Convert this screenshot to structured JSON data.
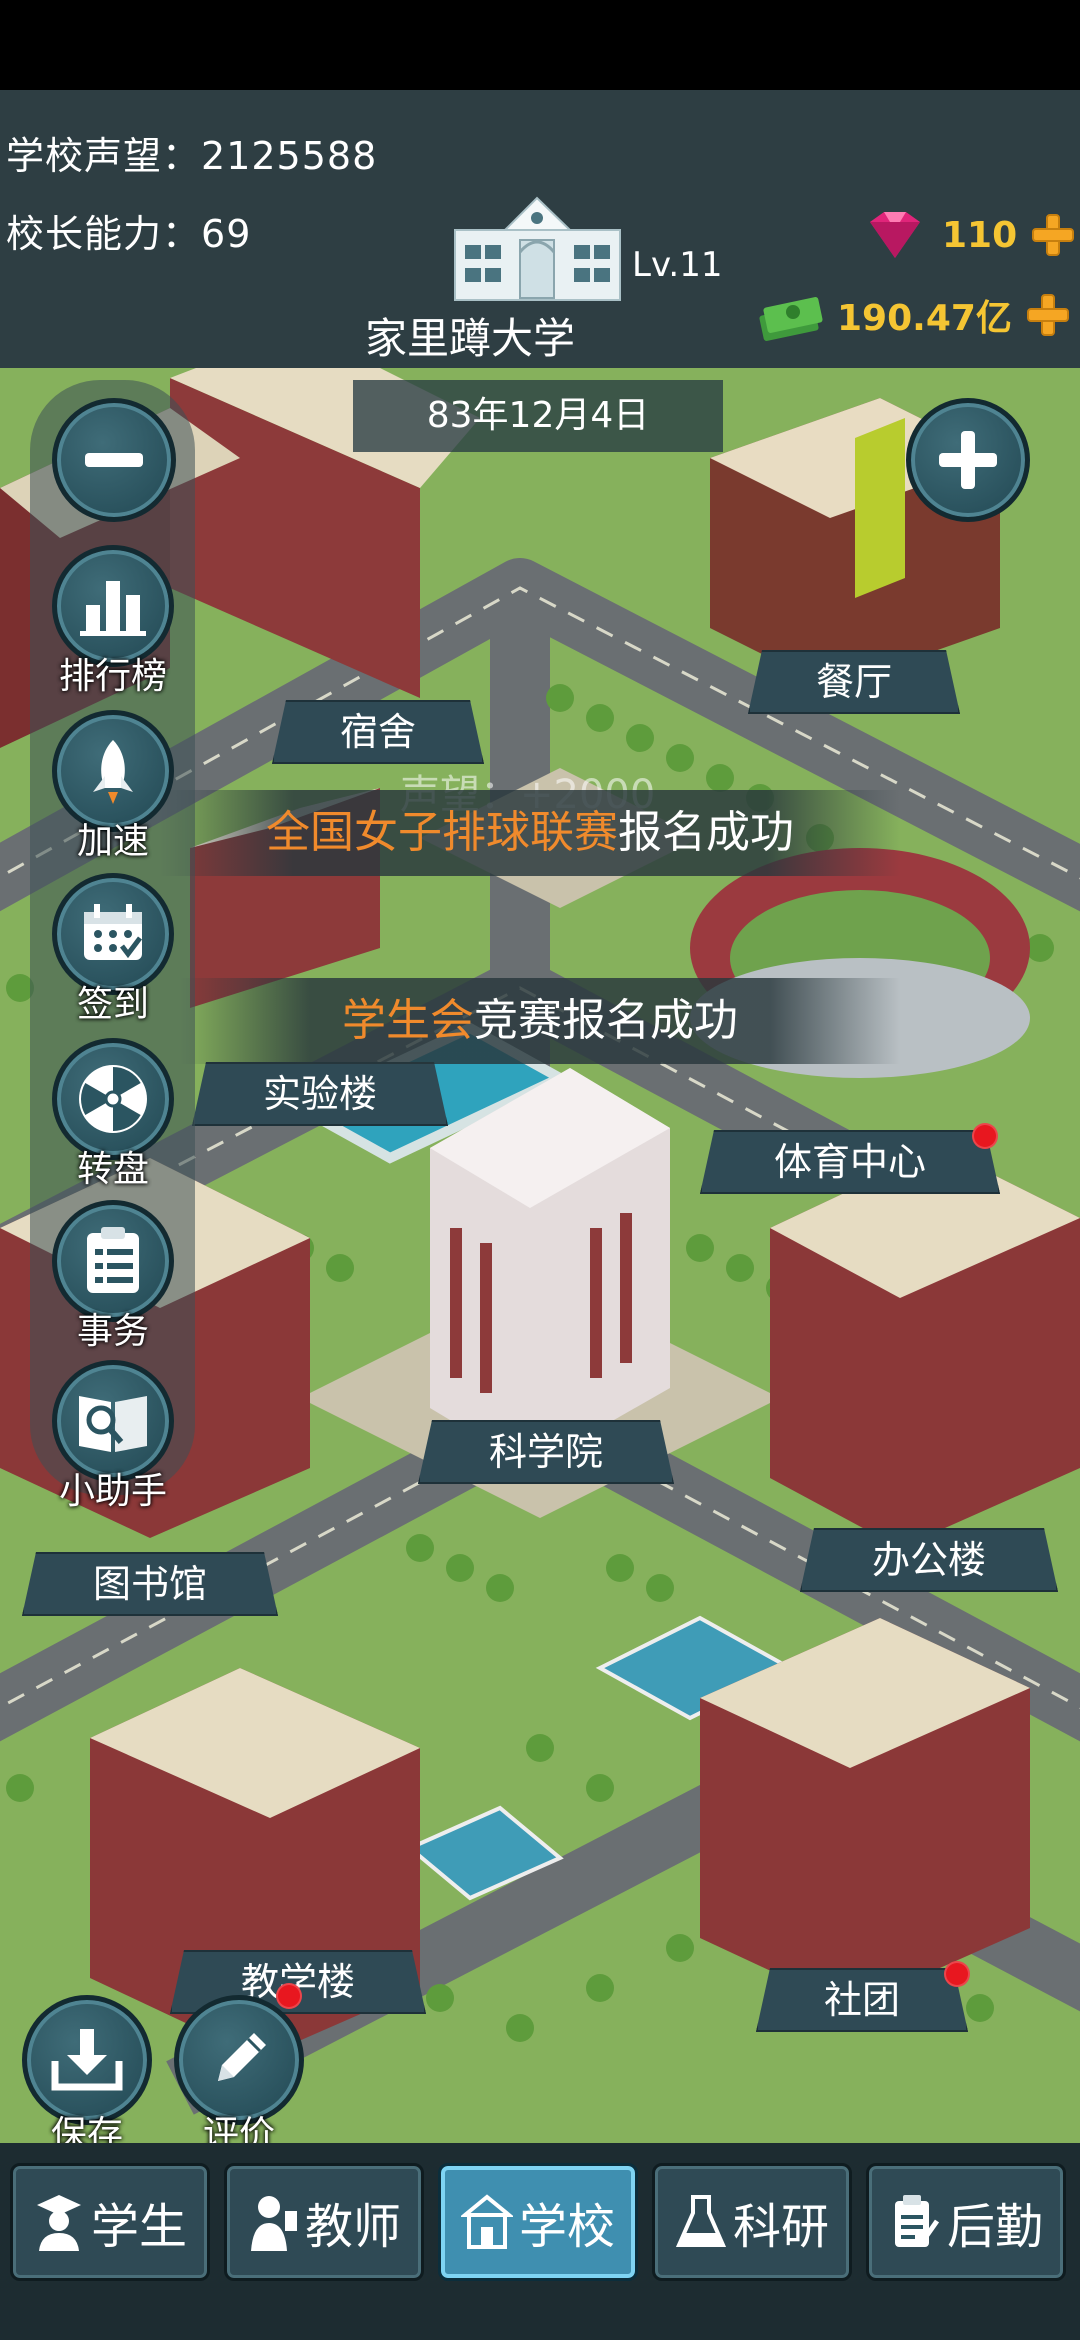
{
  "header": {
    "reputation_label": "学校声望：",
    "reputation_value": "2125588",
    "ability_label": "校长能力：",
    "ability_value": "69",
    "school_level": "Lv.11",
    "school_name": "家里蹲大学",
    "gems": "110",
    "money": "190.47亿",
    "gem_icon": "gem-icon",
    "money_icon": "cash-icon"
  },
  "map": {
    "date": "83年12月4日",
    "buildings": [
      {
        "label": "宿舍"
      },
      {
        "label": "餐厅"
      },
      {
        "label": "实验楼"
      },
      {
        "label": "体育中心"
      },
      {
        "label": "科学院"
      },
      {
        "label": "办公楼"
      },
      {
        "label": "图书馆"
      },
      {
        "label": "教学楼"
      },
      {
        "label": "社团"
      }
    ],
    "notices": [
      {
        "highlight": "全国女子排球联赛",
        "text": "报名成功"
      },
      {
        "highlight": "学生会",
        "text": "竞赛报名成功"
      }
    ],
    "faded_text": "声望：+2000"
  },
  "sidebar": {
    "items": [
      {
        "label": "排行榜",
        "icon": "bar-chart-icon"
      },
      {
        "label": "加速",
        "icon": "rocket-icon"
      },
      {
        "label": "签到",
        "icon": "calendar-icon"
      },
      {
        "label": "转盘",
        "icon": "wheel-icon"
      },
      {
        "label": "事务",
        "icon": "clipboard-icon"
      },
      {
        "label": "小助手",
        "icon": "assistant-icon"
      }
    ]
  },
  "bottom_actions": [
    {
      "label": "保存",
      "icon": "download-icon"
    },
    {
      "label": "评价",
      "icon": "pencil-icon"
    }
  ],
  "tabs": [
    {
      "label": "学生",
      "icon": "student-icon"
    },
    {
      "label": "教师",
      "icon": "teacher-icon"
    },
    {
      "label": "学校",
      "icon": "school-icon",
      "active": true
    },
    {
      "label": "科研",
      "icon": "flask-icon"
    },
    {
      "label": "后勤",
      "icon": "logistics-icon"
    }
  ],
  "colors": {
    "accent_orange": "#f08a2c",
    "gold": "#f5c533",
    "panel": "#2f4a55",
    "active_tab": "#3f8fb0",
    "badge_red": "#e8171f"
  }
}
